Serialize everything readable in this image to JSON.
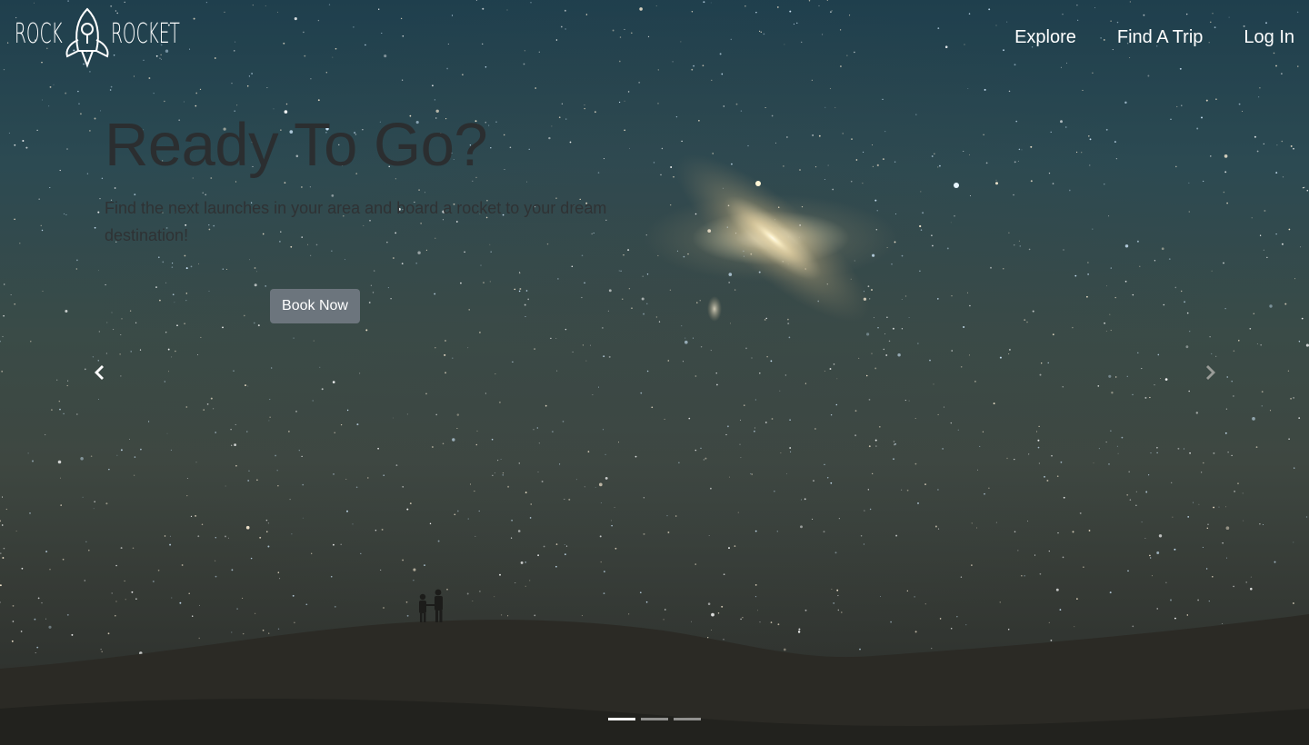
{
  "brand": {
    "left_word": "ROCK",
    "right_word": "ROCKET"
  },
  "nav": {
    "items": [
      {
        "label": "Explore"
      },
      {
        "label": "Find A Trip"
      },
      {
        "label": "Log In"
      }
    ]
  },
  "hero": {
    "headline": "Ready To Go?",
    "description": "Find the next launches in your area and board a rocket to your dream destination!",
    "button_label": "Book Now"
  },
  "carousel": {
    "slide_count": 3,
    "active_index": 0
  },
  "icons": {
    "logo": "rocket-icon",
    "prev": "chevron-left-icon",
    "next": "chevron-right-icon"
  },
  "colors": {
    "button_bg": "#6c757d",
    "nav_text": "#ffffff",
    "headline_text": "#2b2e30"
  }
}
